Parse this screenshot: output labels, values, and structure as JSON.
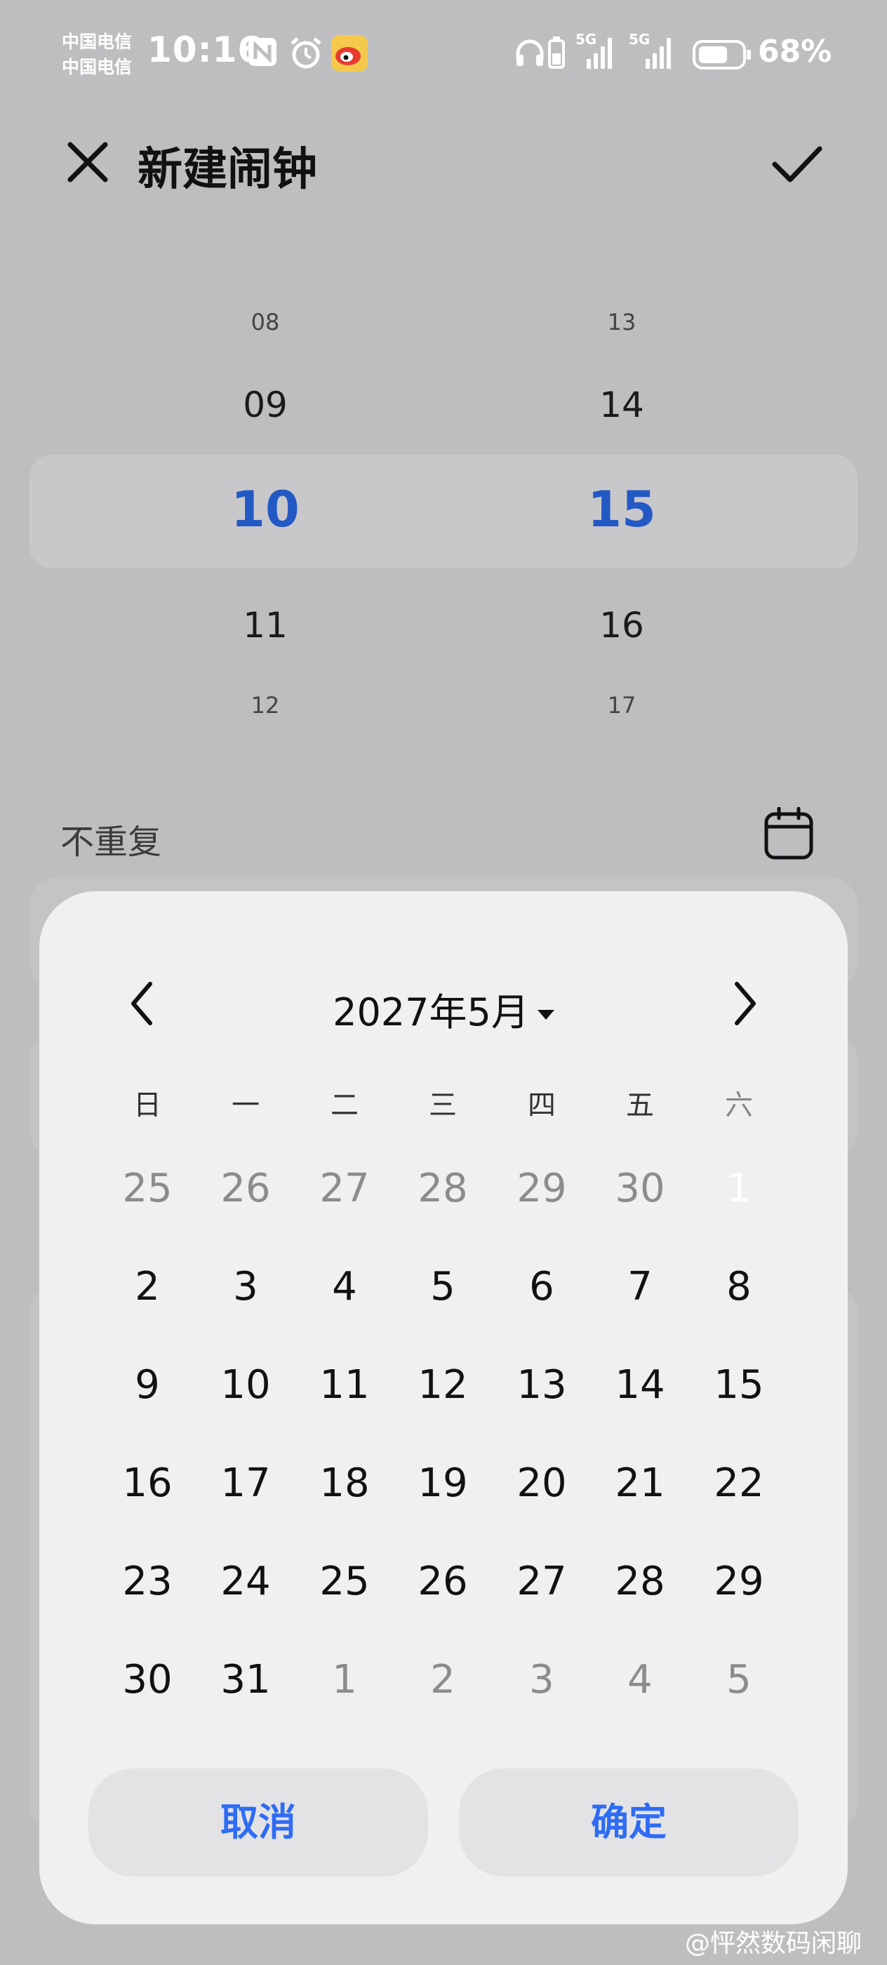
{
  "status_bar": {
    "carrier_1": "中国电信",
    "carrier_2": "中国电信",
    "time": "10:16",
    "network_1": "5G",
    "network_2": "5G",
    "battery": "68%"
  },
  "header": {
    "title": "新建闹钟"
  },
  "time_picker": {
    "hours": [
      "08",
      "09",
      "10",
      "11",
      "12"
    ],
    "minutes": [
      "13",
      "14",
      "15",
      "16",
      "17"
    ],
    "selected_hour": "10",
    "selected_minute": "15"
  },
  "repeat": {
    "label": "不重复"
  },
  "date_dialog": {
    "month_title": "2027年5月",
    "weekdays": [
      "日",
      "一",
      "二",
      "三",
      "四",
      "五",
      "六"
    ],
    "weeks": [
      [
        "25",
        "26",
        "27",
        "28",
        "29",
        "30",
        "1"
      ],
      [
        "2",
        "3",
        "4",
        "5",
        "6",
        "7",
        "8"
      ],
      [
        "9",
        "10",
        "11",
        "12",
        "13",
        "14",
        "15"
      ],
      [
        "16",
        "17",
        "18",
        "19",
        "20",
        "21",
        "22"
      ],
      [
        "23",
        "24",
        "25",
        "26",
        "27",
        "28",
        "29"
      ],
      [
        "30",
        "31",
        "1",
        "2",
        "3",
        "4",
        "5"
      ]
    ],
    "selected_day": "1",
    "cancel_label": "取消",
    "confirm_label": "确定"
  },
  "watermark": "@怦然数码闲聊",
  "colors": {
    "accent": "#2f6cf5",
    "selected_time": "#2359c4"
  }
}
